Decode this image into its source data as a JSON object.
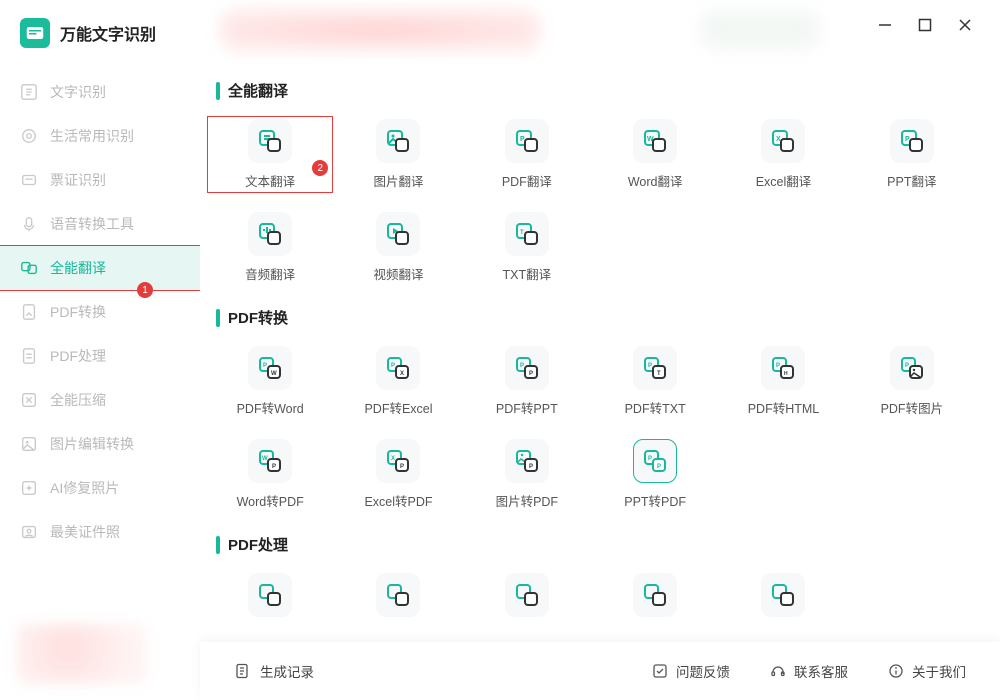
{
  "app": {
    "title": "万能文字识别"
  },
  "sidebar": {
    "items": [
      {
        "label": "文字识别"
      },
      {
        "label": "生活常用识别"
      },
      {
        "label": "票证识别"
      },
      {
        "label": "语音转换工具"
      },
      {
        "label": "全能翻译"
      },
      {
        "label": "PDF转换"
      },
      {
        "label": "PDF处理"
      },
      {
        "label": "全能压缩"
      },
      {
        "label": "图片编辑转换"
      },
      {
        "label": "AI修复照片"
      },
      {
        "label": "最美证件照"
      }
    ],
    "activeIndex": 4,
    "badge": "1"
  },
  "sections": [
    {
      "title": "全能翻译",
      "tiles": [
        {
          "label": "文本翻译",
          "highlighted": true,
          "badge": "2"
        },
        {
          "label": "图片翻译"
        },
        {
          "label": "PDF翻译"
        },
        {
          "label": "Word翻译"
        },
        {
          "label": "Excel翻译"
        },
        {
          "label": "PPT翻译"
        },
        {
          "label": "音频翻译"
        },
        {
          "label": "视频翻译"
        },
        {
          "label": "TXT翻译"
        }
      ]
    },
    {
      "title": "PDF转换",
      "tiles": [
        {
          "label": "PDF转Word"
        },
        {
          "label": "PDF转Excel"
        },
        {
          "label": "PDF转PPT"
        },
        {
          "label": "PDF转TXT"
        },
        {
          "label": "PDF转HTML"
        },
        {
          "label": "PDF转图片"
        },
        {
          "label": "Word转PDF"
        },
        {
          "label": "Excel转PDF"
        },
        {
          "label": "图片转PDF"
        },
        {
          "label": "PPT转PDF",
          "active": true
        }
      ]
    },
    {
      "title": "PDF处理",
      "tiles": [
        {
          "label": ""
        },
        {
          "label": ""
        },
        {
          "label": ""
        },
        {
          "label": ""
        },
        {
          "label": ""
        }
      ]
    }
  ],
  "footer": {
    "generate": "生成记录",
    "feedback": "问题反馈",
    "support": "联系客服",
    "about": "关于我们"
  }
}
